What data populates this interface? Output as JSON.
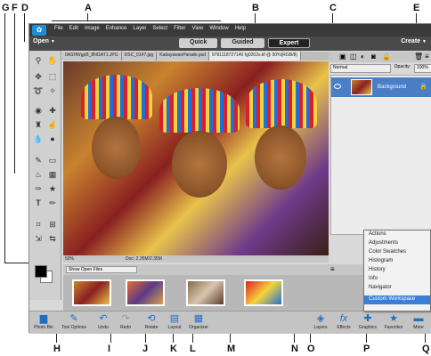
{
  "callouts": {
    "A": "A",
    "B": "B",
    "C": "C",
    "D": "D",
    "E": "E",
    "F": "F",
    "G": "G",
    "H": "H",
    "I": "I",
    "J": "J",
    "K": "K",
    "L": "L",
    "M": "M",
    "N": "N",
    "O": "O",
    "P": "P",
    "Q": "Q"
  },
  "menubar": {
    "items": [
      "File",
      "Edit",
      "Image",
      "Enhance",
      "Layer",
      "Select",
      "Filter",
      "View",
      "Window",
      "Help"
    ]
  },
  "modebar": {
    "open": "Open",
    "tabs": [
      "Quick",
      "Guided",
      "Expert"
    ],
    "active_tab": "Expert",
    "create": "Create"
  },
  "doc_tabs": [
    "0ASHWgpB_8NGAT1.JPG",
    "DSC_0147.jpg",
    "KadayawanParade.psd",
    "9781118727140 fg0202s.tif @ 50%(RGB/8)"
  ],
  "statusbar": {
    "zoom": "50%",
    "doc": "Doc: 2.35M/2.35M"
  },
  "layers": {
    "blend": "Normal",
    "opacity_label": "Opacity:",
    "opacity_value": "100%",
    "layer_name": "Background"
  },
  "photobin": {
    "show": "Show Open Files"
  },
  "bottom_bar": {
    "photo_bin": "Photo Bin",
    "tool_options": "Tool Options",
    "undo": "Undo",
    "redo": "Redo",
    "rotate": "Rotate",
    "layout": "Layout",
    "organizer": "Organizer",
    "layers": "Layers",
    "effects": "Effects",
    "graphics": "Graphics",
    "favorites": "Favorites",
    "more": "More"
  },
  "more_menu": {
    "items": [
      "Actions",
      "Adjustments",
      "Color Swatches",
      "Histogram",
      "History",
      "Info",
      "Navigator"
    ],
    "custom": "Custom Workspace"
  },
  "colors": {
    "accent": "#1b8ed8",
    "menubar": "#3a3a3a",
    "modebar": "#4a4a4a",
    "highlight": "#3a7ed8",
    "layer_selected": "#4a7fc6"
  }
}
